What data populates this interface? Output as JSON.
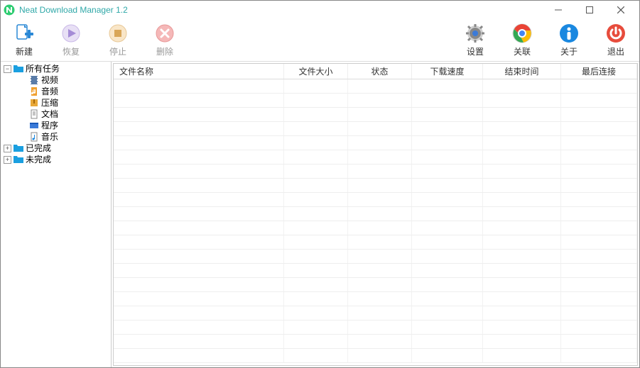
{
  "app": {
    "title": "Neat Download Manager 1.2"
  },
  "toolbar": {
    "new": "新建",
    "resume": "恢复",
    "stop": "停止",
    "delete": "删除",
    "settings": "设置",
    "link": "关联",
    "about": "关于",
    "exit": "退出"
  },
  "tree": {
    "all": "所有任务",
    "video": "视频",
    "audio": "音频",
    "archive": "压缩",
    "document": "文档",
    "program": "程序",
    "music": "音乐",
    "completed": "已完成",
    "incomplete": "未完成"
  },
  "columns": {
    "filename": "文件名称",
    "filesize": "文件大小",
    "status": "状态",
    "speed": "下载速度",
    "endtime": "结束时间",
    "lastconn": "最后连接"
  },
  "colors": {
    "folder_blue": "#1a9fe0",
    "accent_green": "#2ecc71"
  }
}
